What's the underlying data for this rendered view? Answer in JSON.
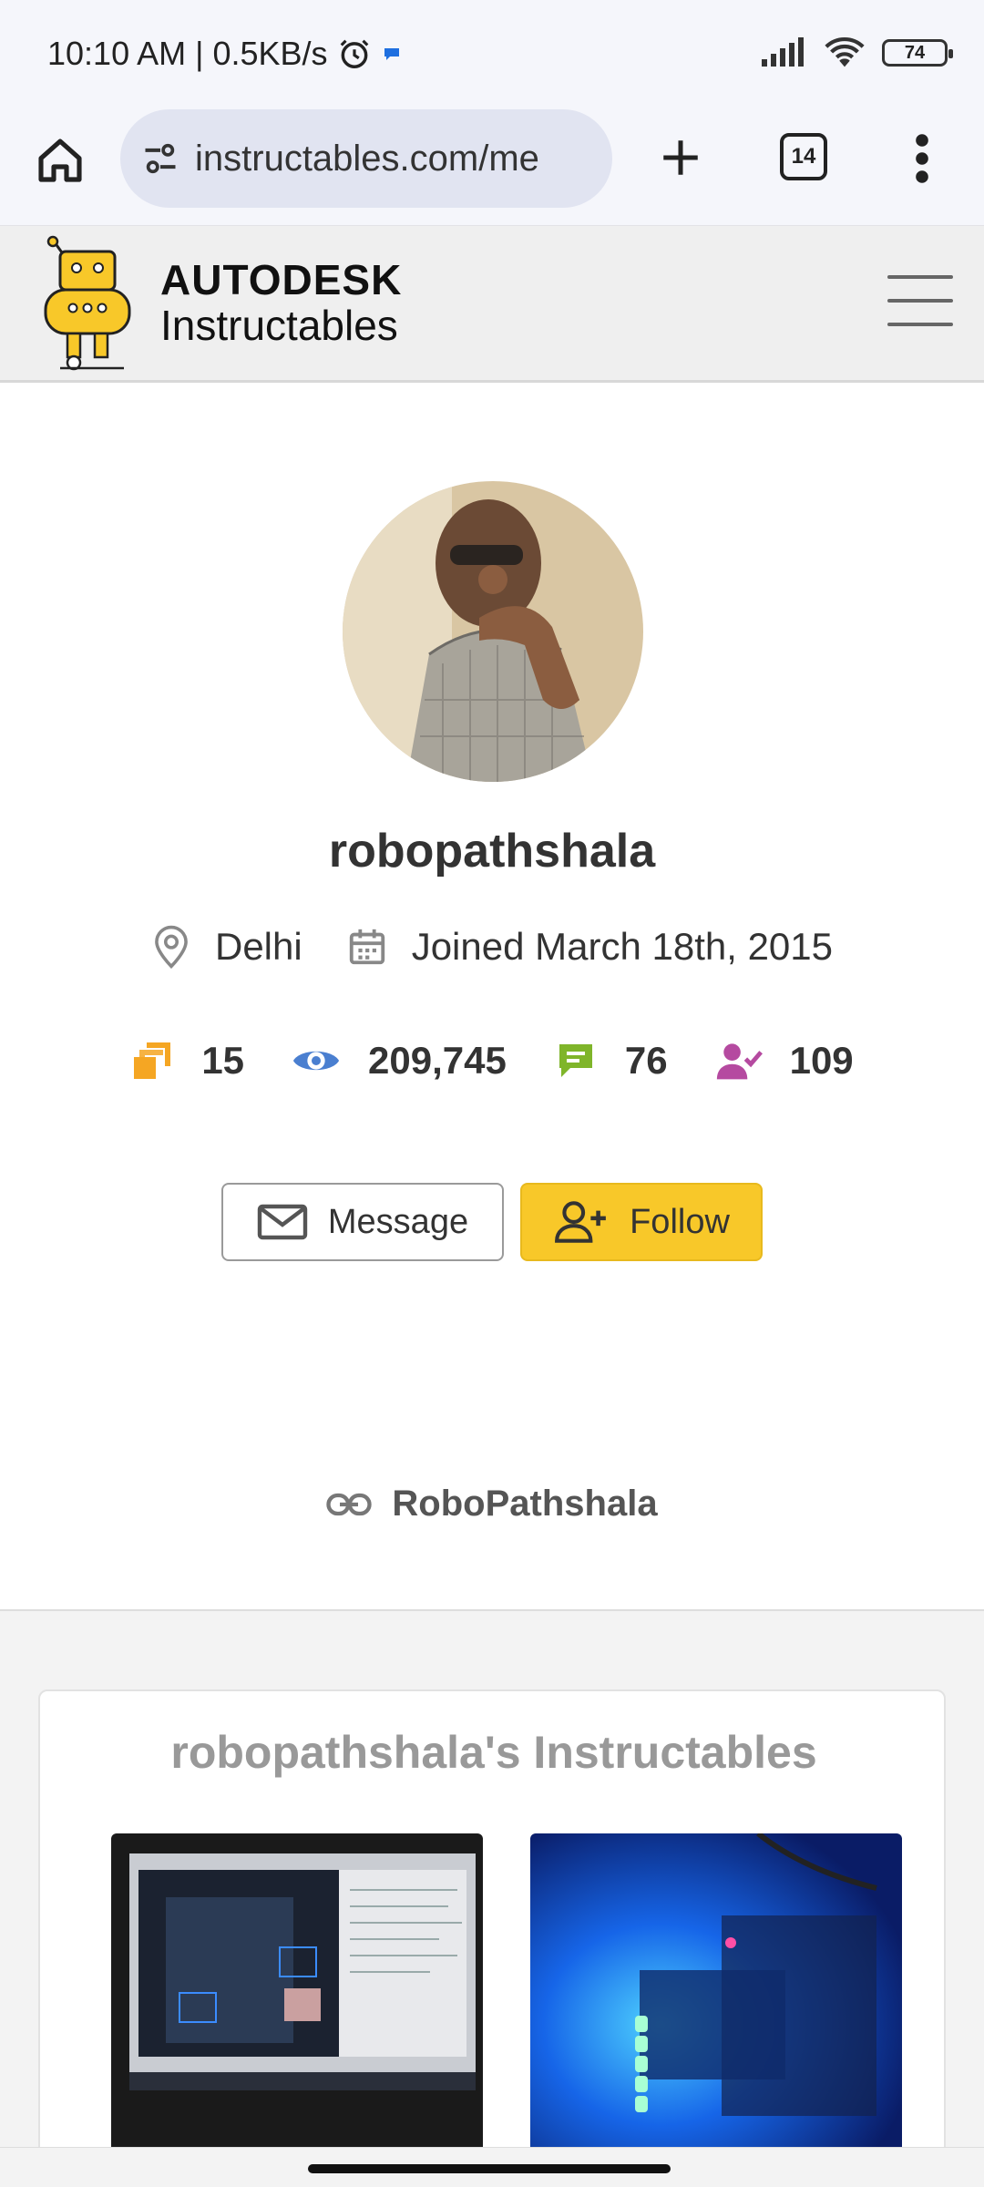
{
  "status_bar": {
    "time_speed": "10:10 AM | 0.5KB/s",
    "battery": "74"
  },
  "browser": {
    "url": "instructables.com/me",
    "tab_count": "14"
  },
  "site": {
    "brand_top": "AUTODESK",
    "brand_bottom": "Instructables"
  },
  "profile": {
    "username": "robopathshala",
    "location": "Delhi",
    "joined": "Joined March 18th, 2015",
    "stats": {
      "instructables": "15",
      "views": "209,745",
      "comments": "76",
      "followers": "109"
    },
    "message_label": "Message",
    "follow_label": "Follow",
    "website_label": "RoboPathshala"
  },
  "instructables_section": {
    "title": "robopathshala's Instructables"
  },
  "colors": {
    "follow_bg": "#f8c829",
    "views_icon": "#4a7fd0",
    "comments_icon": "#7fb52a",
    "followers_icon": "#b54aa0",
    "instructables_icon": "#f5a623"
  }
}
